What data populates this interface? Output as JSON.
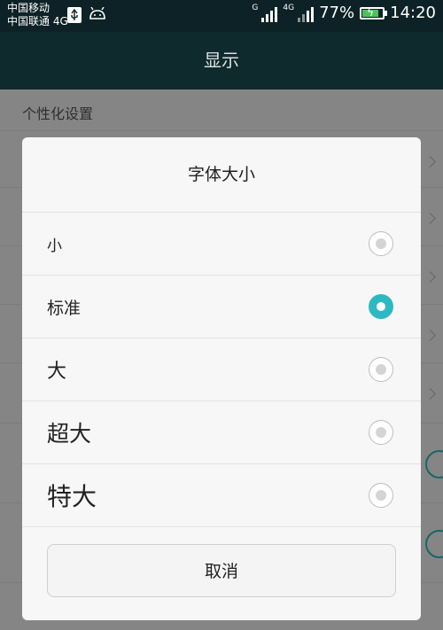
{
  "status_bar": {
    "carrier_1": "中国移动",
    "carrier_2": "中国联通 4G",
    "net_label_1": "G",
    "net_label_2": "4G",
    "battery_percent": "77%",
    "time": "14:20",
    "icons": [
      "usb-icon",
      "android-debug-icon",
      "signal-icon",
      "battery-charging-icon"
    ]
  },
  "header": {
    "title": "显示"
  },
  "background": {
    "section_title": "个性化设置"
  },
  "dialog": {
    "title": "字体大小",
    "options": [
      {
        "label": "小",
        "selected": false
      },
      {
        "label": "标准",
        "selected": true
      },
      {
        "label": "大",
        "selected": false
      },
      {
        "label": "超大",
        "selected": false
      },
      {
        "label": "特大",
        "selected": false
      }
    ],
    "cancel_label": "取消"
  },
  "colors": {
    "accent": "#2cb9c2",
    "status_bar_bg": "#0d2226",
    "header_bg": "#0f2a2d"
  }
}
